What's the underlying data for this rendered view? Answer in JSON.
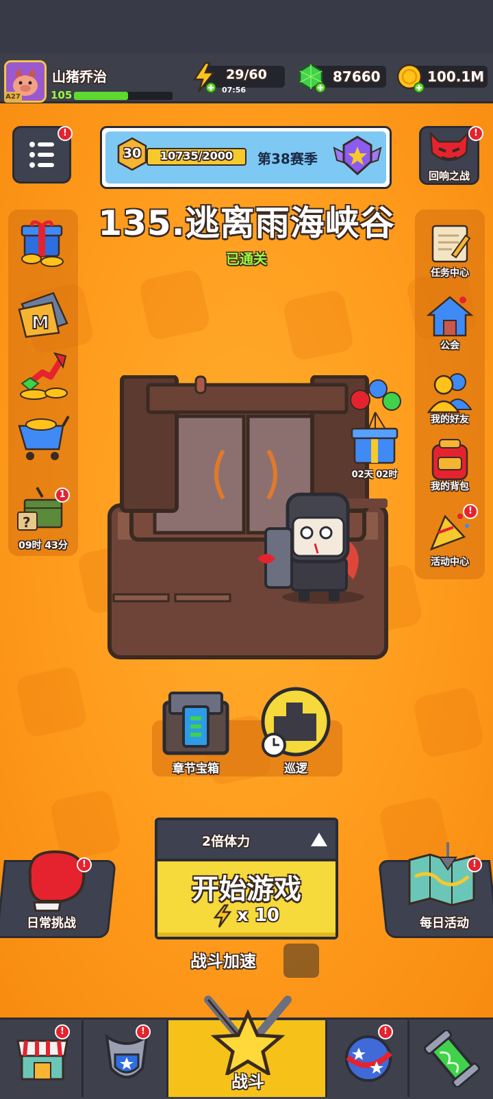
{
  "player": {
    "name": "山猪乔治",
    "level": "105",
    "avatar_tag": "A27",
    "xp_fraction": 0.55
  },
  "resources": {
    "energy": "29/60",
    "energy_timer": "07:56",
    "gems": "87660",
    "coins": "100.1M"
  },
  "season": {
    "level": "30",
    "progress": "10735/2000",
    "label": "第38赛季"
  },
  "stage": {
    "title": "135.逃离雨海峡谷",
    "status": "已通关"
  },
  "left_icons": {
    "mystery_timer": "09时 43分",
    "mystery_badge": "1"
  },
  "right_icons": {
    "echo_battle": "回响之战",
    "tasks": "任务中心",
    "guild": "公会",
    "friends": "我的好友",
    "backpack": "我的背包",
    "events": "活动中心"
  },
  "gift_timer": "02天 02时",
  "chapter_chest": "章节宝箱",
  "patrol": "巡逻",
  "start": {
    "multiplier": "2倍体力",
    "label": "开始游戏",
    "cost": "x 10"
  },
  "daily_challenge": "日常挑战",
  "daily_activity": "每日活动",
  "battle_speed": "战斗加速",
  "nav": {
    "battle": "战斗"
  },
  "colors": {
    "background": "#ff9b1c",
    "topbar": "#3d3f4b",
    "start_button": "#f6d93a",
    "season_panel": "#7ec8f4",
    "stage_status": "#9dfb3a"
  }
}
